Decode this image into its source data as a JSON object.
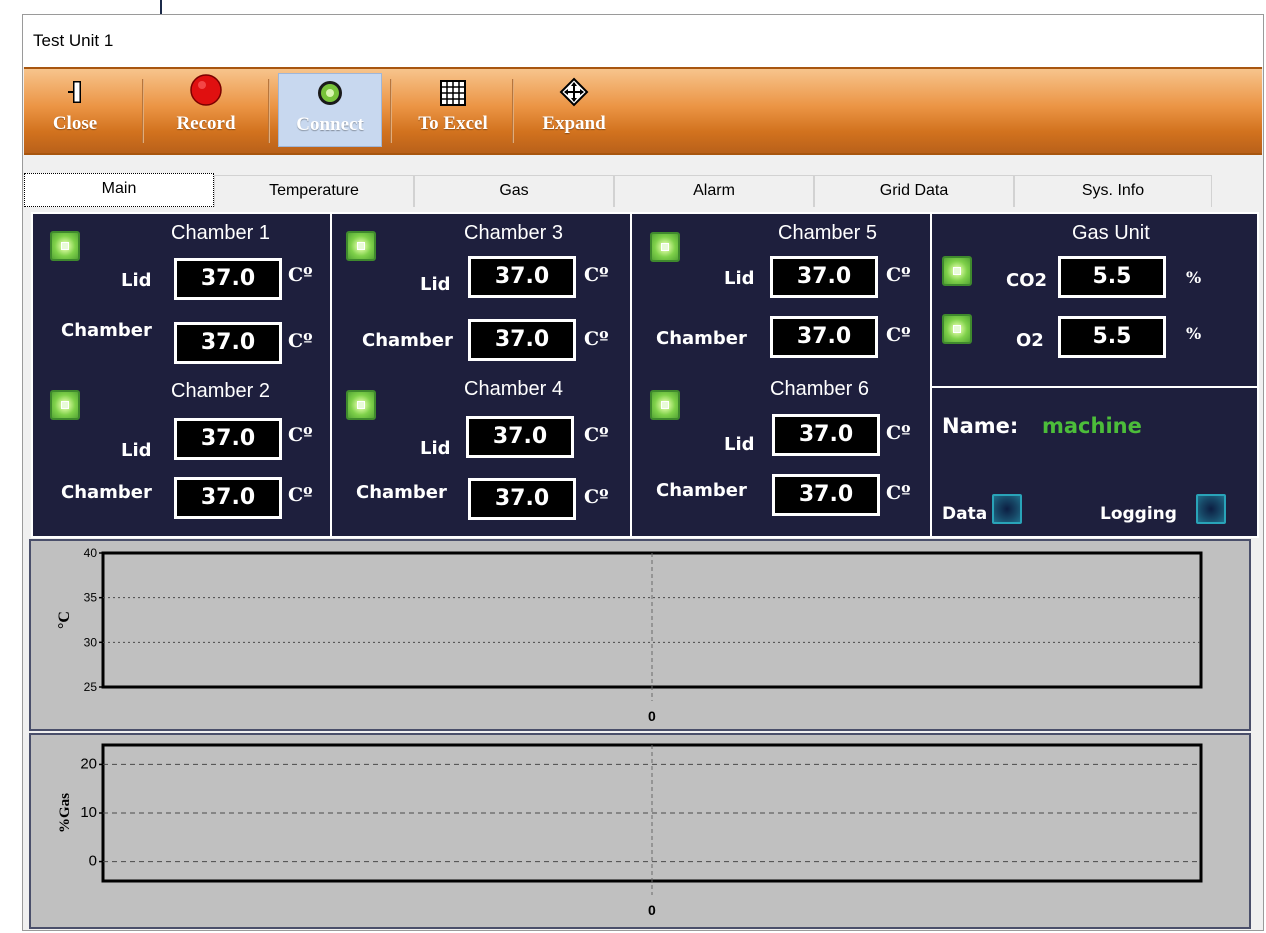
{
  "window": {
    "title": "Test Unit 1"
  },
  "toolbar": {
    "buttons": [
      {
        "label": "Close",
        "icon": "door-exit-icon"
      },
      {
        "label": "Record",
        "icon": "red-record-icon"
      },
      {
        "label": "Connect",
        "icon": "green-connect-icon",
        "active": true
      },
      {
        "label": "To Excel",
        "icon": "grid-table-icon"
      },
      {
        "label": "Expand",
        "icon": "expand-arrows-icon"
      }
    ]
  },
  "tabs": [
    "Main",
    "Temperature",
    "Gas",
    "Alarm",
    "Grid Data",
    "Sys. Info"
  ],
  "selected_tab": "Main",
  "labels": {
    "lid": "Lid",
    "chamber": "Chamber",
    "unit_temp": "Cº",
    "unit_pct": "%"
  },
  "chambers": [
    {
      "name": "Chamber 1",
      "lid": "37.0",
      "chamber": "37.0"
    },
    {
      "name": "Chamber 2",
      "lid": "37.0",
      "chamber": "37.0"
    },
    {
      "name": "Chamber 3",
      "lid": "37.0",
      "chamber": "37.0"
    },
    {
      "name": "Chamber 4",
      "lid": "37.0",
      "chamber": "37.0"
    },
    {
      "name": "Chamber 5",
      "lid": "37.0",
      "chamber": "37.0"
    },
    {
      "name": "Chamber 6",
      "lid": "37.0",
      "chamber": "37.0"
    }
  ],
  "gas_unit": {
    "title": "Gas Unit",
    "co2_label": "CO2",
    "co2_value": "5.5",
    "o2_label": "O2",
    "o2_value": "5.5"
  },
  "name_panel": {
    "name_label": "Name:",
    "name_value": "machine",
    "data_label": "Data",
    "logging_label": "Logging"
  },
  "colors": {
    "toolbar_orange": "#e0822e",
    "panel_navy": "#1e1f3d",
    "led_green": "#7fd14a",
    "name_green": "#4cbd3a",
    "chart_bg": "#c0c0c0"
  },
  "chart_data": [
    {
      "type": "line",
      "ylabel": "°C",
      "ylim": [
        25,
        40
      ],
      "yticks": [
        25,
        30,
        35,
        40
      ],
      "xticks": [
        "0"
      ],
      "series": [],
      "grid": "dotted"
    },
    {
      "type": "line",
      "ylabel": "%Gas",
      "ylim": [
        -4,
        24
      ],
      "yticks": [
        0,
        10,
        20
      ],
      "xticks": [
        "0"
      ],
      "series": [],
      "grid": "dashed"
    }
  ]
}
